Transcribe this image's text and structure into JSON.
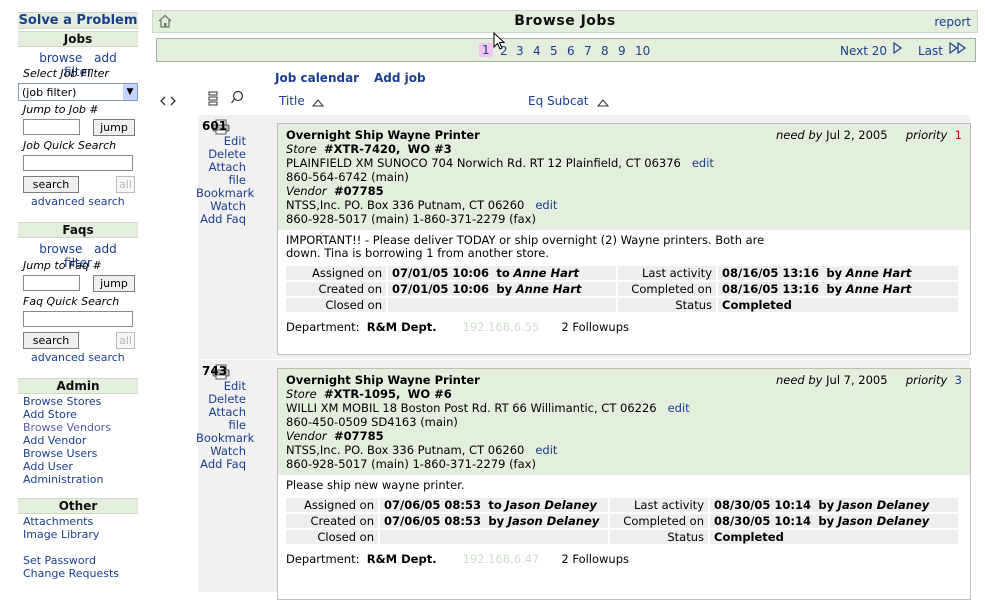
{
  "sidebar": {
    "solve_title": "Solve a Problem",
    "jobs": {
      "title": "Jobs",
      "browse": "browse",
      "add": "add",
      "filter": "filter",
      "select_label": "Select Job Filter",
      "select_value": "(job filter)",
      "jump_label": "Jump to Job #",
      "jump_btn": "jump",
      "quick_label": "Job Quick Search",
      "search_btn": "search",
      "all_btn": "all",
      "advanced": "advanced search"
    },
    "faqs": {
      "title": "Faqs",
      "browse": "browse",
      "add": "add",
      "filter": "filter",
      "jump_label": "Jump to Faq #",
      "jump_btn": "jump",
      "quick_label": "Faq Quick Search",
      "search_btn": "search",
      "all_btn": "all",
      "advanced": "advanced search"
    },
    "admin": {
      "title": "Admin",
      "items": [
        "Browse Stores",
        "Add Store",
        "Browse Vendors",
        "Add Vendor",
        "Browse Users",
        "Add User",
        "Administration"
      ]
    },
    "other": {
      "title": "Other",
      "items": [
        "Attachments",
        "Image Library"
      ],
      "items2": [
        "Set Password",
        "Change Requests"
      ]
    }
  },
  "header": {
    "title": "Browse Jobs",
    "report": "report"
  },
  "pager": {
    "pages": [
      "1",
      "2",
      "3",
      "4",
      "5",
      "6",
      "7",
      "8",
      "9",
      "10"
    ],
    "current": "1",
    "next": "Next 20",
    "last": "Last"
  },
  "toolbar": {
    "job_calendar": "Job calendar",
    "add_job": "Add job"
  },
  "columns": {
    "title": "Title",
    "eq_subcat": "Eq Subcat"
  },
  "jobs": [
    {
      "id": "601",
      "actions": [
        "Edit",
        "Delete",
        "Attach file",
        "Bookmark",
        "Watch",
        "Add Faq"
      ],
      "title": "Overnight Ship Wayne Printer",
      "need_by_label": "need by",
      "need_by": "Jul 2, 2005",
      "priority_label": "priority",
      "priority": "1",
      "store_label": "Store",
      "store_id": "#XTR-7420,",
      "wo": "WO #3",
      "store_addr": "PLAINFIELD XM SUNOCO  704 Norwich Rd. RT 12 Plainfield, CT  06376",
      "store_phone": "860-564-6742 (main)",
      "vendor_label": "Vendor",
      "vendor_id": "#07785",
      "vendor_addr": "NTSS,Inc.  PO. Box 336 Putnam, CT  06260",
      "vendor_phone": "860-928-5017 (main)   1-860-371-2279 (fax)",
      "edit": "edit",
      "description": "IMPORTANT!! - Please deliver TODAY or ship overnight (2) Wayne printers. Both are down. Tina is borrowing 1 from another store.",
      "assigned_label": "Assigned on",
      "assigned_on": "07/01/05 10:06",
      "assigned_prep": "to",
      "assigned_to": "Anne Hart",
      "created_label": "Created on",
      "created_on": "07/01/05 10:06",
      "created_prep": "by",
      "created_by": "Anne Hart",
      "closed_label": "Closed on",
      "closed_on": "",
      "last_label": "Last activity",
      "last_activity": "08/16/05 13:16",
      "last_prep": "by",
      "last_by": "Anne Hart",
      "completed_label": "Completed on",
      "completed_on": "08/16/05 13:16",
      "completed_prep": "by",
      "completed_by": "Anne Hart",
      "status_label": "Status",
      "status": "Completed",
      "dept_label": "Department:",
      "dept": "R&M Dept.",
      "ip": "192.168.6.55",
      "followups": "2 Followups",
      "priority_color": "#cc0000"
    },
    {
      "id": "743",
      "actions": [
        "Edit",
        "Delete",
        "Attach file",
        "Bookmark",
        "Watch",
        "Add Faq"
      ],
      "title": "Overnight Ship Wayne Printer",
      "need_by_label": "need by",
      "need_by": "Jul 7, 2005",
      "priority_label": "priority",
      "priority": "3",
      "store_label": "Store",
      "store_id": "#XTR-1095,",
      "wo": "WO #6",
      "store_addr": "WILLI XM MOBIL  18 Boston Post Rd. RT 66 Willimantic, CT  06226",
      "store_phone": "860-450-0509 SD4163 (main)",
      "vendor_label": "Vendor",
      "vendor_id": "#07785",
      "vendor_addr": "NTSS,Inc.  PO. Box 336 Putnam, CT  06260",
      "vendor_phone": "860-928-5017 (main)   1-860-371-2279 (fax)",
      "edit": "edit",
      "description": "Please ship new wayne printer.",
      "assigned_label": "Assigned on",
      "assigned_on": "07/06/05 08:53",
      "assigned_prep": "to",
      "assigned_to": "Jason Delaney",
      "created_label": "Created on",
      "created_on": "07/06/05 08:53",
      "created_prep": "by",
      "created_by": "Jason Delaney",
      "closed_label": "Closed on",
      "closed_on": "",
      "last_label": "Last activity",
      "last_activity": "08/30/05 10:14",
      "last_prep": "by",
      "last_by": "Jason Delaney",
      "completed_label": "Completed on",
      "completed_on": "08/30/05 10:14",
      "completed_prep": "by",
      "completed_by": "Jason Delaney",
      "status_label": "Status",
      "status": "Completed",
      "dept_label": "Department:",
      "dept": "R&M Dept.",
      "ip": "192.168.6.47",
      "followups": "2 Followups",
      "priority_color": "#1a3f8f"
    }
  ],
  "colors": {
    "accent_bg": "#e4eedd",
    "link": "#1a3f8f",
    "current_page": "#f4c6f1"
  }
}
